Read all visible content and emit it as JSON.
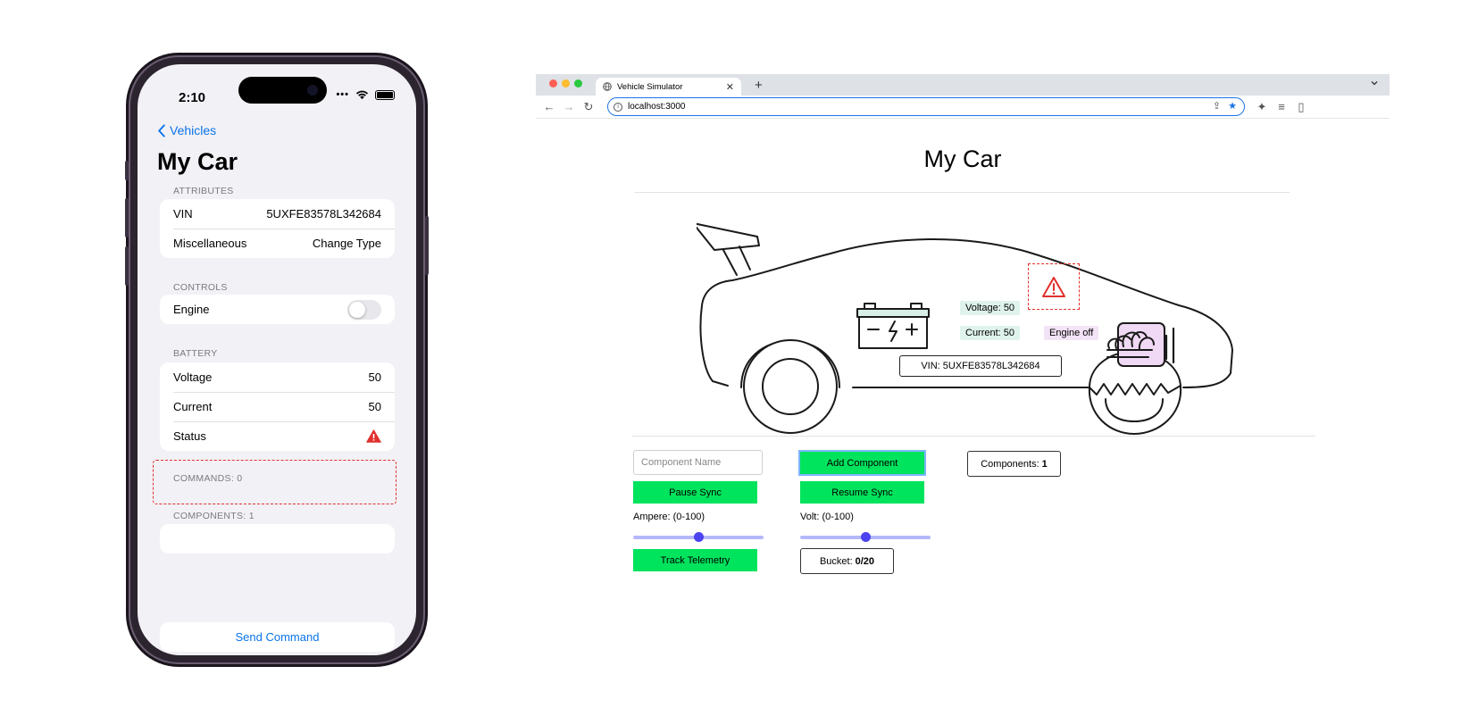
{
  "phone": {
    "status_time": "2:10",
    "back_label": "Vehicles",
    "title": "My Car",
    "attributes": {
      "header": "ATTRIBUTES",
      "vin_label": "VIN",
      "vin_value": "5UXFE83578L342684",
      "misc_label": "Miscellaneous",
      "misc_value": "Change Type"
    },
    "controls": {
      "header": "CONTROLS",
      "engine_label": "Engine",
      "engine_on": false
    },
    "battery": {
      "header": "BATTERY",
      "voltage_label": "Voltage",
      "voltage_value": "50",
      "current_label": "Current",
      "current_value": "50",
      "status_label": "Status",
      "status_icon": "warning-icon",
      "status_color": "#e1302d"
    },
    "commands_header": "COMMANDS: 0",
    "components_header": "COMPONENTS: 1",
    "send_command_label": "Send Command",
    "accent_color": "#0a74ea"
  },
  "browser": {
    "tab_title": "Vehicle Simulator",
    "url": "localhost:3000",
    "page": {
      "title": "My Car",
      "voltage_chip": "Voltage: 50",
      "current_chip": "Current: 50",
      "engine_chip": "Engine off",
      "vin_label": "VIN: 5UXFE83578L342684",
      "component_placeholder": "Component Name",
      "add_component_label": "Add Component",
      "components_label": "Components:",
      "components_count": "1",
      "pause_sync_label": "Pause Sync",
      "resume_sync_label": "Resume Sync",
      "ampere_label": "Ampere: (0-100)",
      "ampere_value": 50,
      "volt_label": "Volt: (0-100)",
      "volt_value": 50,
      "track_telemetry_label": "Track Telemetry",
      "bucket_label": "Bucket:",
      "bucket_value": "0/20",
      "button_color": "#00e35d",
      "slider_color": "#4b43f0"
    }
  }
}
